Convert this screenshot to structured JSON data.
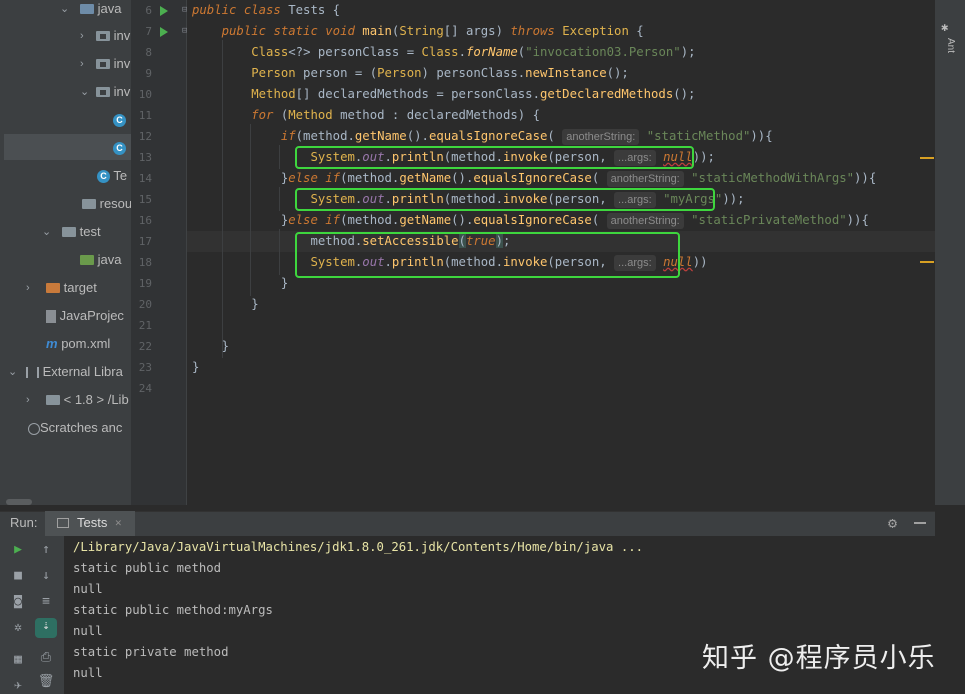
{
  "project_tree": {
    "items": [
      {
        "label": "java",
        "icon": "folder-icon"
      },
      {
        "label": "inv",
        "icon": "package-icon"
      },
      {
        "label": "inv",
        "icon": "package-icon"
      },
      {
        "label": "inv",
        "icon": "package-icon"
      },
      {
        "label": "",
        "icon": "class-icon"
      },
      {
        "label": "",
        "icon": "class-icon"
      },
      {
        "label": "Te",
        "icon": "class-icon"
      },
      {
        "label": "resou",
        "icon": "folder-icon"
      },
      {
        "label": "test",
        "icon": "folder-icon"
      },
      {
        "label": "java",
        "icon": "folder-icon"
      },
      {
        "label": "target",
        "icon": "folder-icon"
      },
      {
        "label": "JavaProjec",
        "icon": "file-icon"
      },
      {
        "label": "pom.xml",
        "icon": "maven-icon"
      },
      {
        "label": "External Libra",
        "icon": "library-icon"
      },
      {
        "label": "< 1.8 > /Lib",
        "icon": "jdk-icon"
      },
      {
        "label": "Scratches anc",
        "icon": "scratches-icon"
      }
    ]
  },
  "editor": {
    "line_numbers": [
      "6",
      "7",
      "8",
      "9",
      "10",
      "11",
      "12",
      "13",
      "14",
      "15",
      "16",
      "17",
      "18",
      "19",
      "20",
      "21",
      "22",
      "23",
      "24"
    ],
    "hints": {
      "another_string": "anotherString:",
      "args": "...args:"
    },
    "strings": {
      "class_name": "\"invocation03.Person\"",
      "static_method": "\"staticMethod\"",
      "static_with_args": "\"staticMethodWithArgs\"",
      "my_args": "\"myArgs\"",
      "static_private": "\"staticPrivateMethod\""
    }
  },
  "right_strip": {
    "labels": [
      "Ant"
    ]
  },
  "run_panel": {
    "label": "Run:",
    "tab_label": "Tests",
    "console_lines": [
      "/Library/Java/JavaVirtualMachines/jdk1.8.0_261.jdk/Contents/Home/bin/java ...",
      "static public method",
      "null",
      "static public method:myArgs",
      "null",
      "static private method",
      "null"
    ]
  },
  "watermark": {
    "text": "知乎 @程序员小乐"
  },
  "colors": {
    "highlight_box": "#3ed63e",
    "keyword": "#cc7832",
    "string": "#6a8759",
    "method": "#ffc66d",
    "field": "#9876aa"
  }
}
